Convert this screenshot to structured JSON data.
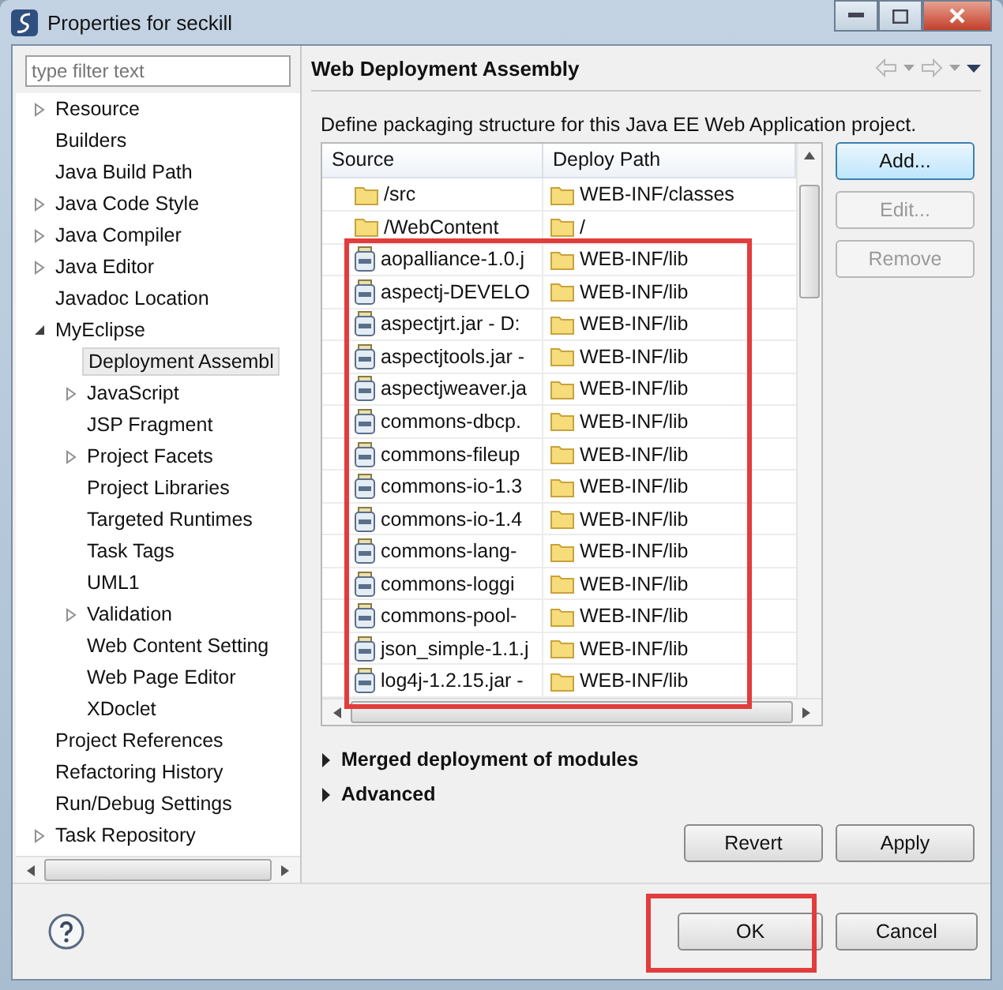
{
  "window": {
    "title": "Properties for seckill"
  },
  "filter": {
    "placeholder": "type filter text"
  },
  "tree": [
    {
      "label": "Resource",
      "expanded": false,
      "selected": false
    },
    {
      "label": "Builders",
      "selected": false
    },
    {
      "label": "Java Build Path",
      "selected": false
    },
    {
      "label": "Java Code Style",
      "expanded": false,
      "selected": false
    },
    {
      "label": "Java Compiler",
      "expanded": false,
      "selected": false
    },
    {
      "label": "Java Editor",
      "expanded": false,
      "selected": false
    },
    {
      "label": "Javadoc Location",
      "selected": false
    },
    {
      "label": "MyEclipse",
      "expanded": true,
      "selected": false,
      "children": [
        {
          "label": "Deployment Assembl",
          "selected": true
        },
        {
          "label": "JavaScript",
          "expanded": false,
          "selected": false
        },
        {
          "label": "JSP Fragment",
          "selected": false
        },
        {
          "label": "Project Facets",
          "expanded": false,
          "selected": false
        },
        {
          "label": "Project Libraries",
          "selected": false
        },
        {
          "label": "Targeted Runtimes",
          "selected": false
        },
        {
          "label": "Task Tags",
          "selected": false
        },
        {
          "label": "UML1",
          "selected": false
        },
        {
          "label": "Validation",
          "expanded": false,
          "selected": false
        },
        {
          "label": "Web Content Setting",
          "selected": false
        },
        {
          "label": "Web Page Editor",
          "selected": false
        },
        {
          "label": "XDoclet",
          "selected": false
        }
      ]
    },
    {
      "label": "Project References",
      "selected": false
    },
    {
      "label": "Refactoring History",
      "selected": false
    },
    {
      "label": "Run/Debug Settings",
      "selected": false
    },
    {
      "label": "Task Repository",
      "expanded": false,
      "selected": false
    }
  ],
  "page": {
    "title": "Web Deployment Assembly",
    "description": "Define packaging structure for this Java EE Web Application project."
  },
  "table": {
    "columns": [
      "Source",
      "Deploy Path"
    ],
    "highlighted": true,
    "rows": [
      {
        "kind": "folder",
        "source": "/src",
        "path": "WEB-INF/classes"
      },
      {
        "kind": "folder",
        "source": "/WebContent",
        "path": "/"
      },
      {
        "kind": "jar",
        "source": "aopalliance-1.0.j",
        "path": "WEB-INF/lib"
      },
      {
        "kind": "jar",
        "source": "aspectj-DEVELO",
        "path": "WEB-INF/lib"
      },
      {
        "kind": "jar",
        "source": "aspectjrt.jar - D:",
        "path": "WEB-INF/lib"
      },
      {
        "kind": "jar",
        "source": "aspectjtools.jar -",
        "path": "WEB-INF/lib"
      },
      {
        "kind": "jar",
        "source": "aspectjweaver.ja",
        "path": "WEB-INF/lib"
      },
      {
        "kind": "jar",
        "source": "commons-dbcp.",
        "path": "WEB-INF/lib"
      },
      {
        "kind": "jar",
        "source": "commons-fileup",
        "path": "WEB-INF/lib"
      },
      {
        "kind": "jar",
        "source": "commons-io-1.3",
        "path": "WEB-INF/lib"
      },
      {
        "kind": "jar",
        "source": "commons-io-1.4",
        "path": "WEB-INF/lib"
      },
      {
        "kind": "jar",
        "source": "commons-lang-",
        "path": "WEB-INF/lib"
      },
      {
        "kind": "jar",
        "source": "commons-loggi",
        "path": "WEB-INF/lib"
      },
      {
        "kind": "jar",
        "source": "commons-pool-",
        "path": "WEB-INF/lib"
      },
      {
        "kind": "jar",
        "source": "json_simple-1.1.j",
        "path": "WEB-INF/lib"
      },
      {
        "kind": "jar",
        "source": "log4j-1.2.15.jar -",
        "path": "WEB-INF/lib"
      }
    ]
  },
  "side_buttons": [
    {
      "label": "Add...",
      "disabled": false
    },
    {
      "label": "Edit...",
      "disabled": true
    },
    {
      "label": "Remove",
      "disabled": true
    }
  ],
  "sections": [
    {
      "label": "Merged deployment of modules",
      "expanded": false
    },
    {
      "label": "Advanced",
      "expanded": false
    }
  ],
  "page_buttons": [
    "Revert",
    "Apply"
  ],
  "dialog_buttons": [
    {
      "label": "OK",
      "highlighted": true
    },
    {
      "label": "Cancel",
      "highlighted": false
    }
  ]
}
